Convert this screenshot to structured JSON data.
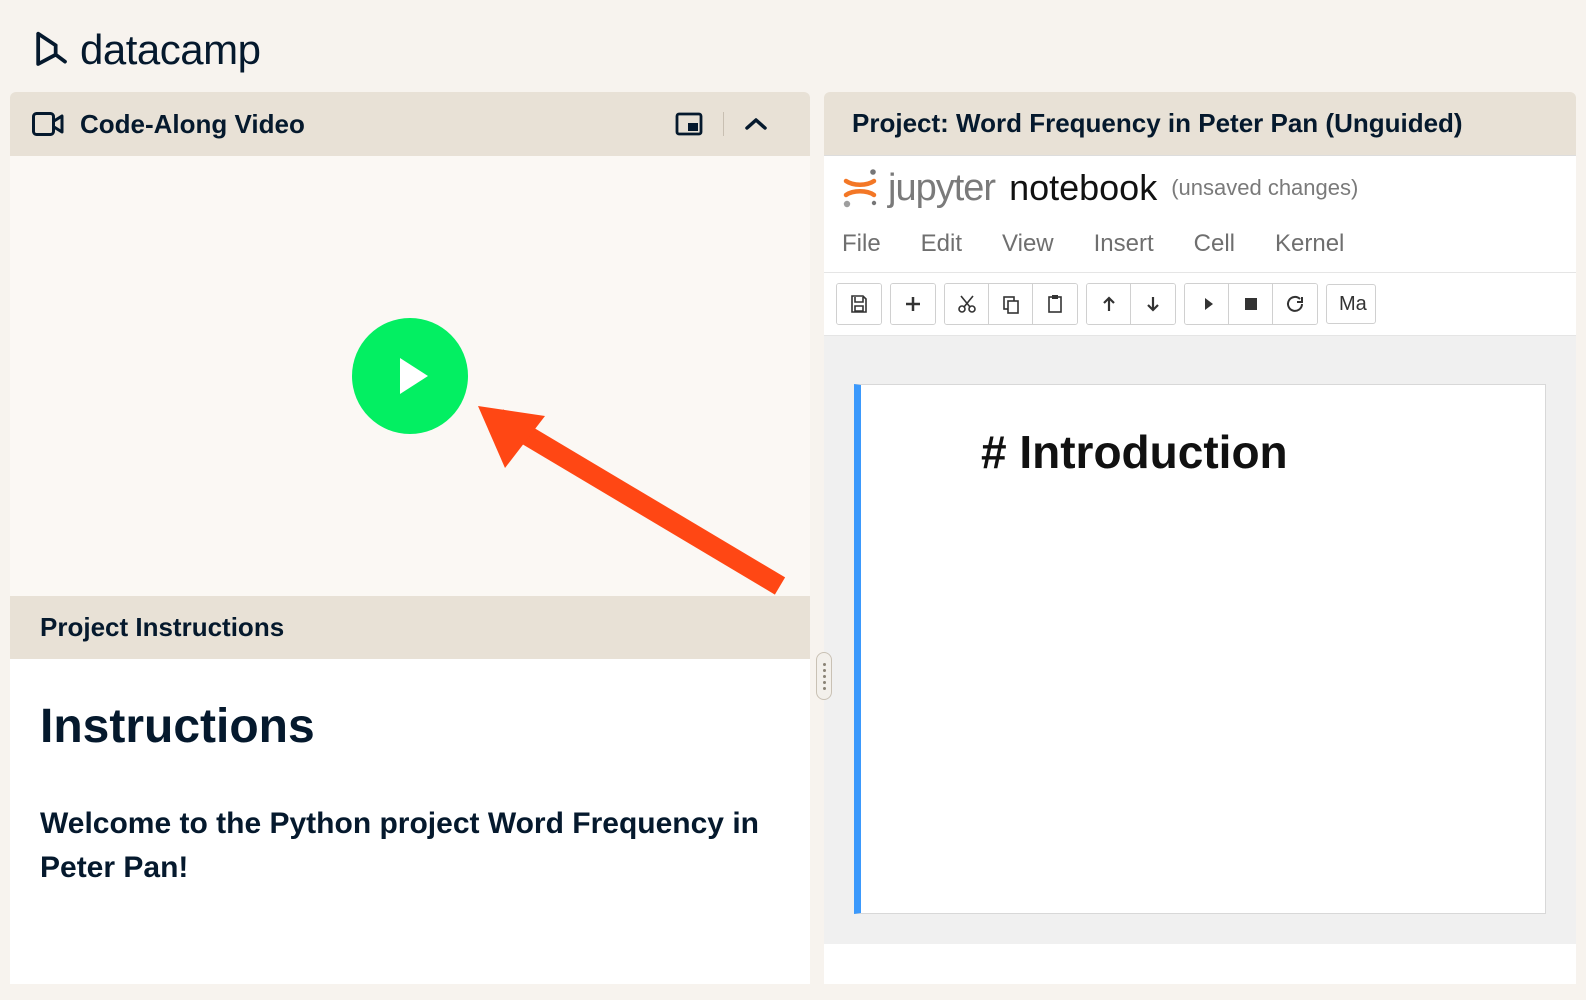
{
  "brand": "datacamp",
  "left": {
    "codeAlongTitle": "Code-Along Video",
    "projectInstructionsTitle": "Project Instructions",
    "instructionsHeading": "Instructions",
    "welcomeText": "Welcome to the Python project Word Frequency in Peter Pan!"
  },
  "right": {
    "projectTitle": "Project: Word Frequency in Peter Pan (Unguided)",
    "jupyter": {
      "brand": "jupyter",
      "notebookName": "notebook",
      "status": "(unsaved changes)",
      "menus": [
        "File",
        "Edit",
        "View",
        "Insert",
        "Cell",
        "Kernel"
      ],
      "cellHeading": "# Introduction",
      "markdownLabel": "Ma"
    }
  }
}
